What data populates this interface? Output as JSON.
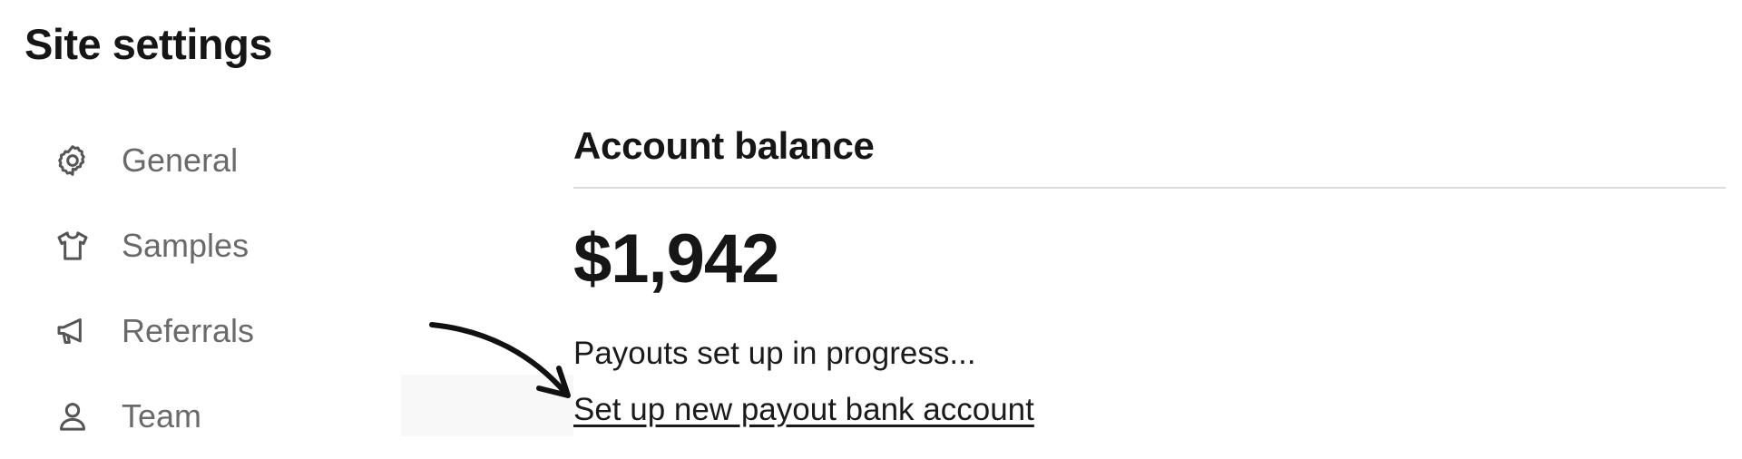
{
  "page": {
    "title": "Site settings"
  },
  "sidebar": {
    "items": [
      {
        "label": "General",
        "icon": "gear-icon"
      },
      {
        "label": "Samples",
        "icon": "tshirt-icon"
      },
      {
        "label": "Referrals",
        "icon": "megaphone-icon"
      },
      {
        "label": "Team",
        "icon": "user-icon"
      }
    ]
  },
  "main": {
    "section_title": "Account balance",
    "balance": "$1,942",
    "payout_status": "Payouts set up in progress...",
    "payout_link": "Set up new payout bank account"
  },
  "colors": {
    "text_primary": "#161616",
    "text_secondary": "#6a6a6a",
    "icon": "#555555",
    "divider": "#dcdcdc",
    "annotation": "#111111"
  }
}
